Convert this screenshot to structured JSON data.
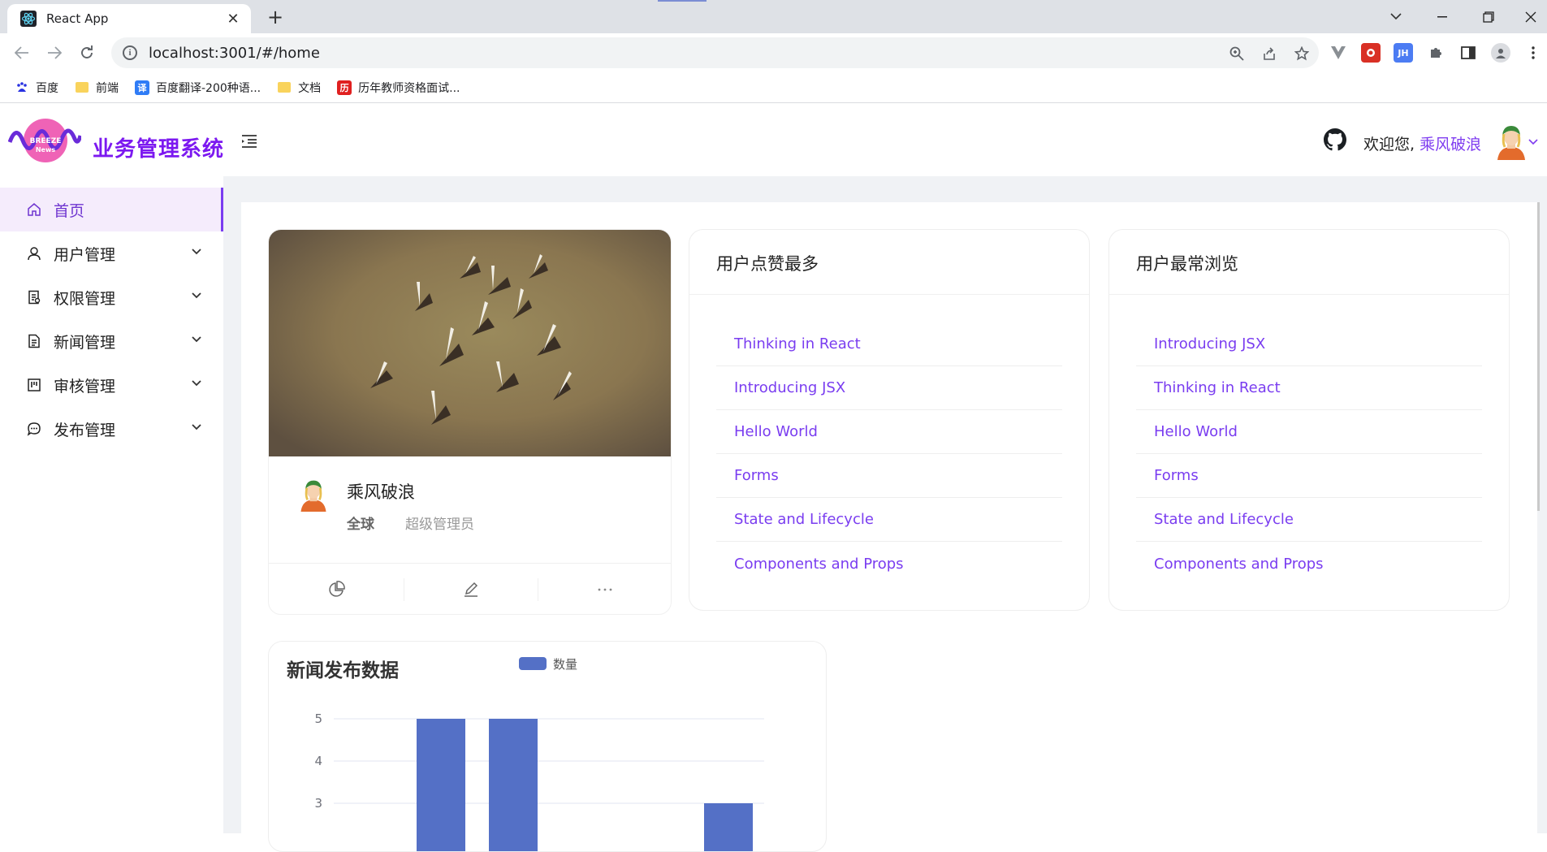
{
  "browser": {
    "tab_title": "React App",
    "url": "localhost:3001/#/home",
    "bookmarks": [
      {
        "label": "百度",
        "icon": "baidu-paw-icon"
      },
      {
        "label": "前端",
        "icon": "folder-icon"
      },
      {
        "label": "百度翻译-200种语...",
        "icon": "baidu-translate-icon"
      },
      {
        "label": "文档",
        "icon": "folder-icon"
      },
      {
        "label": "历年教师资格面试...",
        "icon": "site-favicon-icon"
      }
    ],
    "extensions": [
      "vue-devtools-icon",
      "extension-red-icon",
      "extension-jh-icon",
      "puzzle-icon",
      "sidebar-icon",
      "profile-icon",
      "kebab-menu-icon"
    ]
  },
  "header": {
    "brand": "业务管理系统",
    "welcome_prefix": "欢迎您,",
    "username": "乘风破浪"
  },
  "sidebar": {
    "items": [
      {
        "label": "首页",
        "icon": "home-icon",
        "active": true
      },
      {
        "label": "用户管理",
        "icon": "user-icon"
      },
      {
        "label": "权限管理",
        "icon": "audit-icon"
      },
      {
        "label": "新闻管理",
        "icon": "file-text-icon"
      },
      {
        "label": "审核管理",
        "icon": "project-icon"
      },
      {
        "label": "发布管理",
        "icon": "message-icon"
      }
    ]
  },
  "profile": {
    "name": "乘风破浪",
    "region": "全球",
    "role": "超级管理员",
    "actions": [
      "pie-chart-icon",
      "edit-icon",
      "ellipsis-icon"
    ]
  },
  "most_liked": {
    "title": "用户点赞最多",
    "items": [
      "Thinking in React",
      "Introducing JSX",
      "Hello World",
      "Forms",
      "State and Lifecycle",
      "Components and Props"
    ]
  },
  "most_viewed": {
    "title": "用户最常浏览",
    "items": [
      "Introducing JSX",
      "Thinking in React",
      "Hello World",
      "Forms",
      "State and Lifecycle",
      "Components and Props"
    ]
  },
  "chart": {
    "title": "新闻发布数据",
    "legend": "数量",
    "color": "#5470c6"
  },
  "chart_data": {
    "type": "bar",
    "title": "新闻发布数据",
    "series": [
      {
        "name": "数量",
        "values": [
          5,
          5,
          null,
          3
        ]
      }
    ],
    "y_ticks": [
      3,
      4,
      5
    ],
    "ylim_visible": [
      3,
      5
    ],
    "note_visible": "chart cropped at bottom; categories not visible",
    "grid": true,
    "legend_position": "top-center"
  }
}
